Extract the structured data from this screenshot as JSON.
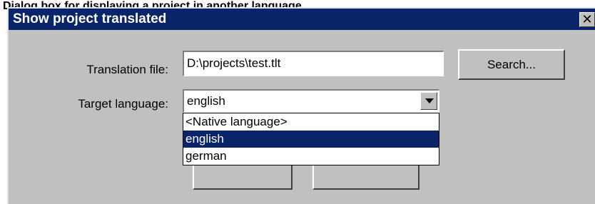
{
  "window": {
    "caption_text": "Dialog box for displaying a project in another language",
    "title": "Show project translated",
    "close_glyph": "✕"
  },
  "form": {
    "translation_label": "Translation file:",
    "translation_value": "D:\\projects\\test.tlt",
    "search_label": "Search...",
    "language_label": "Target language:",
    "language_value": "english"
  },
  "dropdown": {
    "options": [
      "<Native language>",
      "english",
      "german"
    ],
    "selected": "english"
  },
  "colors": {
    "titlebar": "#0a246a",
    "selection": "#0a246a",
    "face": "#c0c0c0"
  }
}
